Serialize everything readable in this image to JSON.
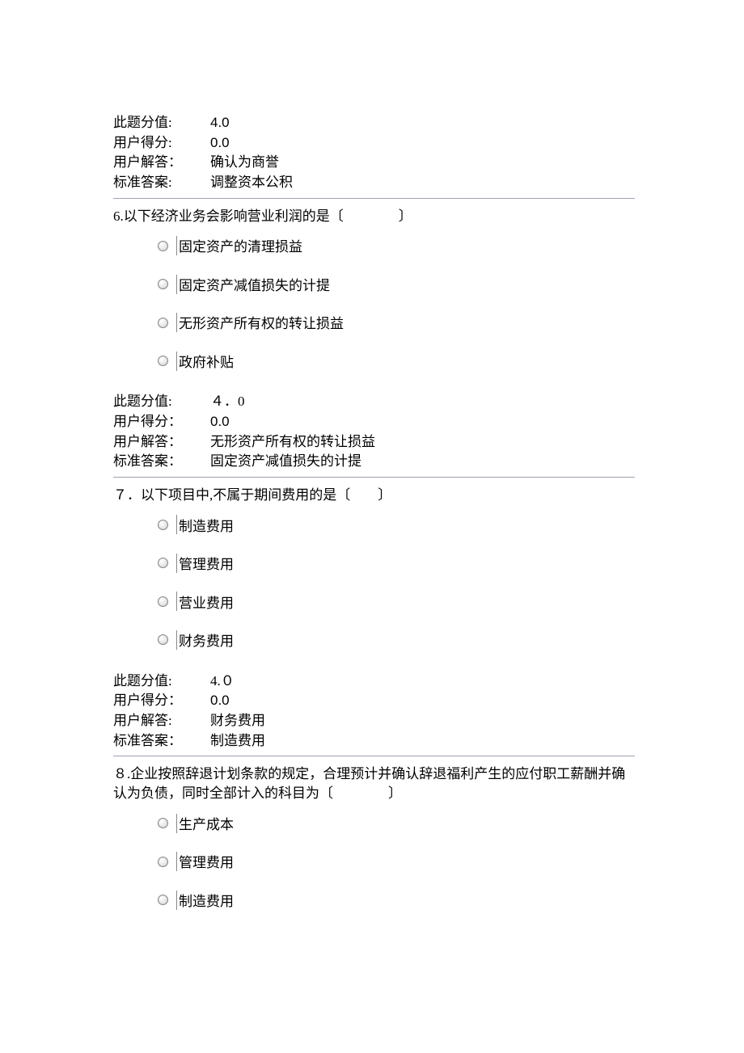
{
  "labels": {
    "score_label": "此题分值:",
    "score_label_colon2": "此题分值:",
    "user_score": "用户得分:",
    "user_score_colon2": "用户得分：",
    "user_answer": "用户解答：",
    "user_answer2": "用户解答:",
    "correct_answer": "标准答案:",
    "correct_answer_colon2": "标准答案："
  },
  "q5_meta": {
    "score": "4.0",
    "user_score": "0.0",
    "user_answer": "确认为商誉",
    "correct_answer": "调整资本公积"
  },
  "q6": {
    "stem": "6.以下经济业务会影响营业利润的是〔　　　　〕",
    "options": [
      "固定资产的清理损益",
      "固定资产减值损失的计提",
      "无形资产所有权的转让损益",
      "政府补贴"
    ],
    "meta": {
      "score": "４．0",
      "user_score": "0.0",
      "user_answer": "无形资产所有权的转让损益",
      "correct_answer": "固定资产减值损失的计提"
    }
  },
  "q7": {
    "stem": "７．以下项目中,不属于期间费用的是〔　　〕",
    "options": [
      "制造费用",
      "管理费用",
      "营业费用",
      "财务费用"
    ],
    "meta": {
      "score": "4.０",
      "user_score": "0.0",
      "user_answer": "财务费用",
      "correct_answer": "制造费用"
    }
  },
  "q8": {
    "stem": "８.企业按照辞退计划条款的规定，合理预计并确认辞退福利产生的应付职工薪酬并确认为负债，同时全部计入的科目为〔　　　　〕",
    "options": [
      "生产成本",
      "管理费用",
      "制造费用"
    ]
  }
}
